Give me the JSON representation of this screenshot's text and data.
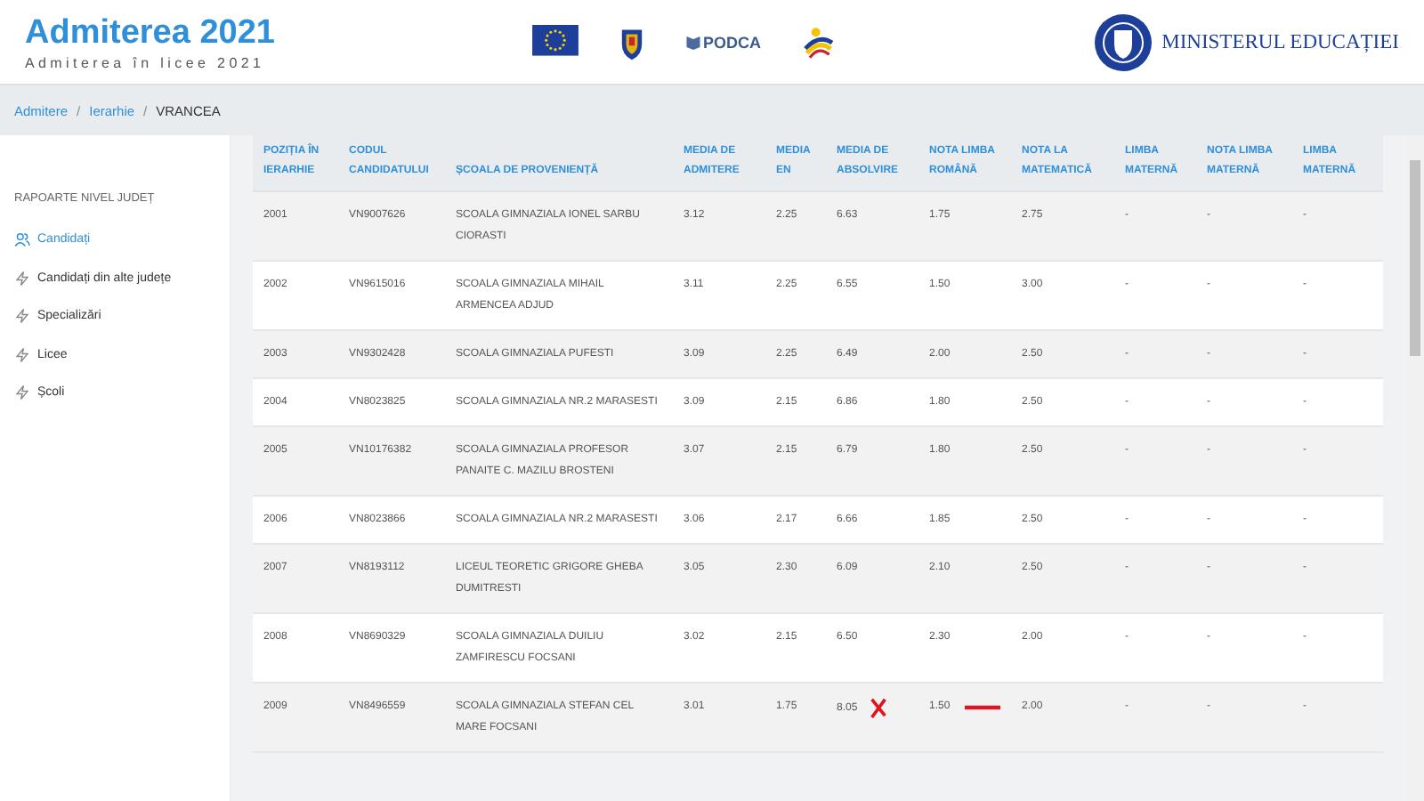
{
  "header": {
    "title": "Admiterea 2021",
    "subtitle": "Admiterea în licee 2021",
    "partner_logo_text": "PODCA",
    "ministry": "MINISTERUL EDUCAȚIEI"
  },
  "breadcrumb": {
    "separator": "/",
    "items": [
      {
        "label": "Admitere",
        "link": true
      },
      {
        "label": "Ierarhie",
        "link": true
      },
      {
        "label": "VRANCEA",
        "link": false
      }
    ]
  },
  "sidebar": {
    "heading": "RAPOARTE NIVEL JUDEȚ",
    "items": [
      {
        "label": "Candidați",
        "selected": true,
        "kind": "people"
      },
      {
        "label": "Candidați din alte județe",
        "selected": false,
        "kind": "bolt"
      },
      {
        "label": "Specializări",
        "selected": false,
        "kind": "bolt"
      },
      {
        "label": "Licee",
        "selected": false,
        "kind": "bolt"
      },
      {
        "label": "Școli",
        "selected": false,
        "kind": "bolt"
      }
    ]
  },
  "table": {
    "columns": [
      "POZIȚIA ÎN IERARHIE",
      "CODUL CANDIDATULUI",
      "ȘCOALA DE PROVENIENȚĂ",
      "MEDIA DE ADMITERE",
      "MEDIA EN",
      "MEDIA DE ABSOLVIRE",
      "NOTA LIMBA ROMÂNĂ",
      "NOTA LA MATEMATICĂ",
      "LIMBA MATERNĂ",
      "NOTA LIMBA MATERNĂ",
      "LIMBA MATERNĂ"
    ],
    "rows": [
      {
        "cells": [
          "2001",
          "VN9007626",
          "SCOALA GIMNAZIALA IONEL SARBU CIORASTI",
          "3.12",
          "2.25",
          "6.63",
          "1.75",
          "2.75",
          "-",
          "-",
          "-"
        ],
        "cross_mark": false,
        "dash_mark": false
      },
      {
        "cells": [
          "2002",
          "VN9615016",
          "SCOALA GIMNAZIALA MIHAIL ARMENCEA ADJUD",
          "3.11",
          "2.25",
          "6.55",
          "1.50",
          "3.00",
          "-",
          "-",
          "-"
        ],
        "cross_mark": false,
        "dash_mark": false
      },
      {
        "cells": [
          "2003",
          "VN9302428",
          "SCOALA GIMNAZIALA PUFESTI",
          "3.09",
          "2.25",
          "6.49",
          "2.00",
          "2.50",
          "-",
          "-",
          "-"
        ],
        "cross_mark": false,
        "dash_mark": false
      },
      {
        "cells": [
          "2004",
          "VN8023825",
          "SCOALA GIMNAZIALA NR.2 MARASESTI",
          "3.09",
          "2.15",
          "6.86",
          "1.80",
          "2.50",
          "-",
          "-",
          "-"
        ],
        "cross_mark": false,
        "dash_mark": false
      },
      {
        "cells": [
          "2005",
          "VN10176382",
          "SCOALA GIMNAZIALA PROFESOR PANAITE C. MAZILU BROSTENI",
          "3.07",
          "2.15",
          "6.79",
          "1.80",
          "2.50",
          "-",
          "-",
          "-"
        ],
        "cross_mark": false,
        "dash_mark": false
      },
      {
        "cells": [
          "2006",
          "VN8023866",
          "SCOALA GIMNAZIALA NR.2 MARASESTI",
          "3.06",
          "2.17",
          "6.66",
          "1.85",
          "2.50",
          "-",
          "-",
          "-"
        ],
        "cross_mark": false,
        "dash_mark": false
      },
      {
        "cells": [
          "2007",
          "VN8193112",
          "LICEUL TEORETIC GRIGORE GHEBA DUMITRESTI",
          "3.05",
          "2.30",
          "6.09",
          "2.10",
          "2.50",
          "-",
          "-",
          "-"
        ],
        "cross_mark": false,
        "dash_mark": false
      },
      {
        "cells": [
          "2008",
          "VN8690329",
          "SCOALA GIMNAZIALA DUILIU ZAMFIRESCU FOCSANI",
          "3.02",
          "2.15",
          "6.50",
          "2.30",
          "2.00",
          "-",
          "-",
          "-"
        ],
        "cross_mark": false,
        "dash_mark": false
      },
      {
        "cells": [
          "2009",
          "VN8496559",
          "SCOALA GIMNAZIALA STEFAN CEL MARE FOCSANI",
          "3.01",
          "1.75",
          "8.05",
          "1.50",
          "2.00",
          "-",
          "-",
          "-"
        ],
        "cross_mark": true,
        "dash_mark": true
      }
    ]
  }
}
